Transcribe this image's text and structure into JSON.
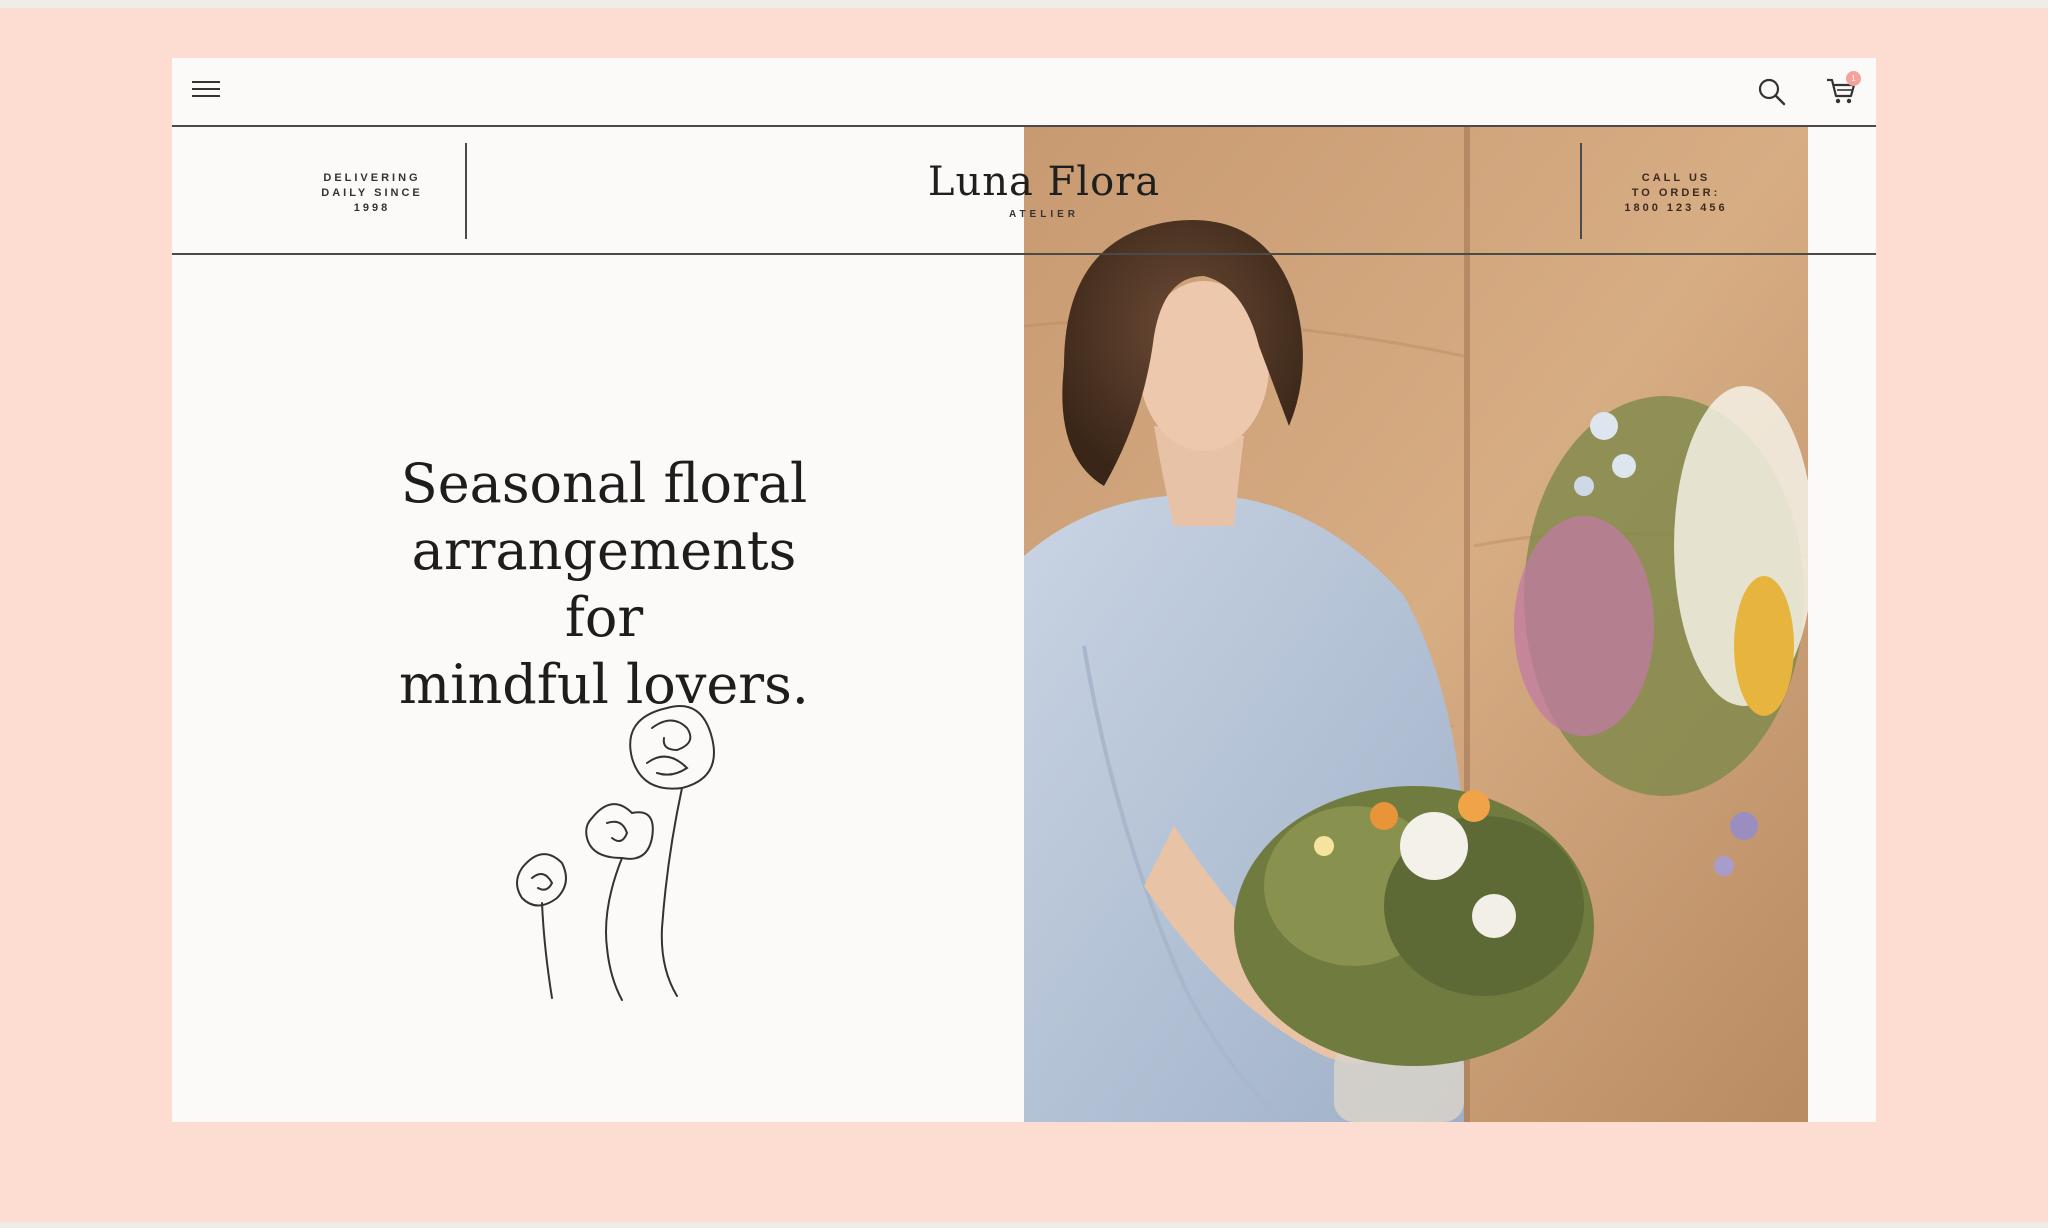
{
  "nav": {
    "menu_icon": "hamburger-menu-icon",
    "search_icon": "search-icon",
    "cart_icon": "cart-icon",
    "cart_count": "1"
  },
  "brand": {
    "tagline": "DELIVERING\nDAILY SINCE\n1998",
    "name": "Luna Flora",
    "subtitle": "ATELIER",
    "order_line": "CALL US\nTO ORDER:\n1800 123 456"
  },
  "hero": {
    "headline": "Seasonal floral\narrangements for\nmindful lovers.",
    "illustration": "flower-line-drawing",
    "image": "florist-with-bouquet-photo"
  },
  "colors": {
    "background": "#fddcd1",
    "card": "#fbfaf8",
    "accent": "#f4a39a",
    "text": "#1d1d1d"
  }
}
